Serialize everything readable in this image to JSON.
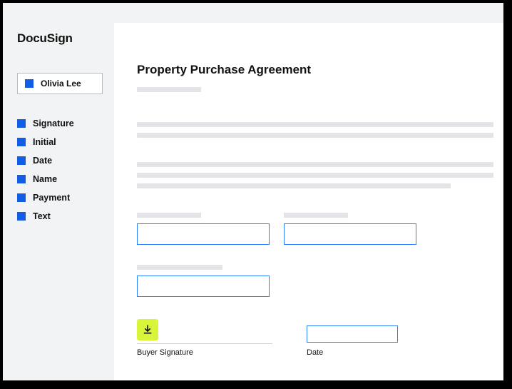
{
  "brand": "DocuSign",
  "recipient": {
    "name": "Olivia Lee"
  },
  "fields": [
    {
      "label": "Signature"
    },
    {
      "label": "Initial"
    },
    {
      "label": "Date"
    },
    {
      "label": "Name"
    },
    {
      "label": "Payment"
    },
    {
      "label": "Text"
    }
  ],
  "document": {
    "title": "Property Purchase Agreement",
    "signature_label": "Buyer Signature",
    "date_label": "Date"
  }
}
